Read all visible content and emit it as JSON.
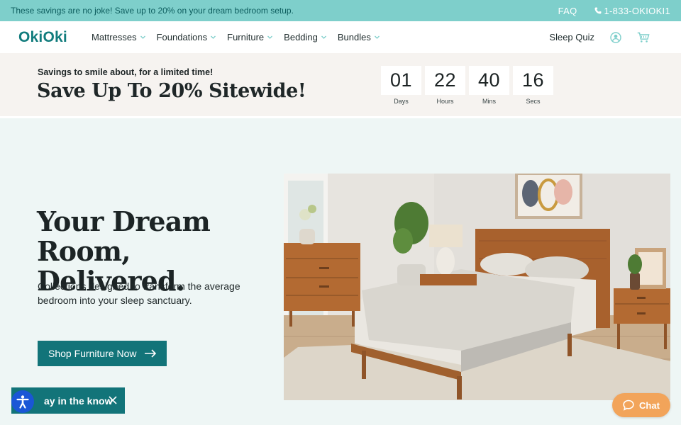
{
  "announcement": {
    "text": "These savings are no joke! Save up to 20% on your dream bedroom setup.",
    "faq_label": "FAQ",
    "phone": "1-833-OKIOKI1"
  },
  "header": {
    "logo": "OkiOki",
    "nav": [
      {
        "label": "Mattresses"
      },
      {
        "label": "Foundations"
      },
      {
        "label": "Furniture"
      },
      {
        "label": "Bedding"
      },
      {
        "label": "Bundles"
      }
    ],
    "sleep_quiz": "Sleep Quiz",
    "icons": {
      "account": "account-icon",
      "cart": "cart-icon"
    }
  },
  "promo": {
    "subtitle": "Savings to smile about, for a limited time!",
    "title": "Save Up To 20% Sitewide!",
    "countdown": [
      {
        "value": "01",
        "label": "Days"
      },
      {
        "value": "22",
        "label": "Hours"
      },
      {
        "value": "40",
        "label": "Mins"
      },
      {
        "value": "16",
        "label": "Secs"
      }
    ]
  },
  "hero": {
    "title": "Your Dream Room, Delivered.",
    "description": "Collections designed to transform the average bedroom into your sleep sanctuary.",
    "cta_label": "Shop Furniture Now",
    "image_icon": "bedroom-photo"
  },
  "floating": {
    "know_label": "ay in the know",
    "chat_label": "Chat",
    "accessibility_icon": "accessibility-icon"
  },
  "colors": {
    "accent": "#127479",
    "announcement_bg": "#7ecfcb",
    "promo_bg": "#f6f3f0",
    "hero_bg": "#eef6f5",
    "chat": "#f2a45a",
    "accessibility": "#1a56d6"
  }
}
